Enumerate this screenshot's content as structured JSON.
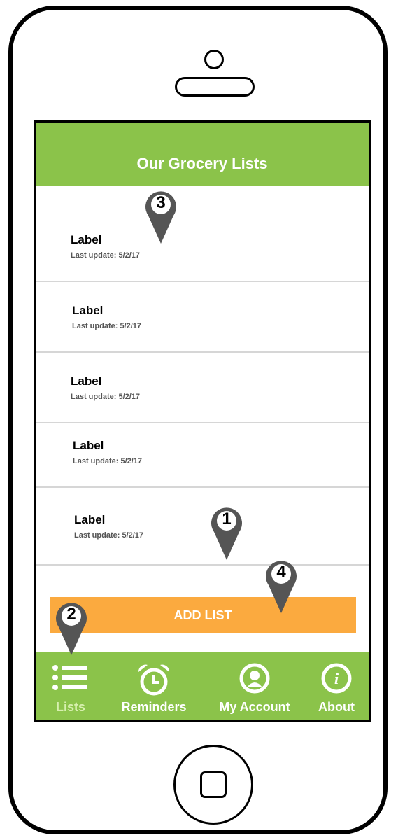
{
  "header": {
    "title": "Our Grocery Lists"
  },
  "lists": [
    {
      "label": "Label",
      "subtitle": "Last update: 5/2/17"
    },
    {
      "label": "Label",
      "subtitle": "Last update: 5/2/17"
    },
    {
      "label": "Label",
      "subtitle": "Last update: 5/2/17"
    },
    {
      "label": "Label",
      "subtitle": "Last update: 5/2/17"
    },
    {
      "label": "Label",
      "subtitle": "Last update: 5/2/17"
    }
  ],
  "add_button": {
    "label": "ADD LIST"
  },
  "tabs": [
    {
      "label": "Lists",
      "icon": "list-icon",
      "active": true
    },
    {
      "label": "Reminders",
      "icon": "alarm-clock-icon"
    },
    {
      "label": "My Account",
      "icon": "account-icon"
    },
    {
      "label": "About",
      "icon": "info-icon"
    }
  ],
  "annotations": [
    {
      "number": "1"
    },
    {
      "number": "2"
    },
    {
      "number": "3"
    },
    {
      "number": "4"
    }
  ],
  "colors": {
    "header": "#8bc34a",
    "add_button": "#fbaa3f",
    "tabbar": "#8bc34a",
    "pin": "#555555"
  }
}
